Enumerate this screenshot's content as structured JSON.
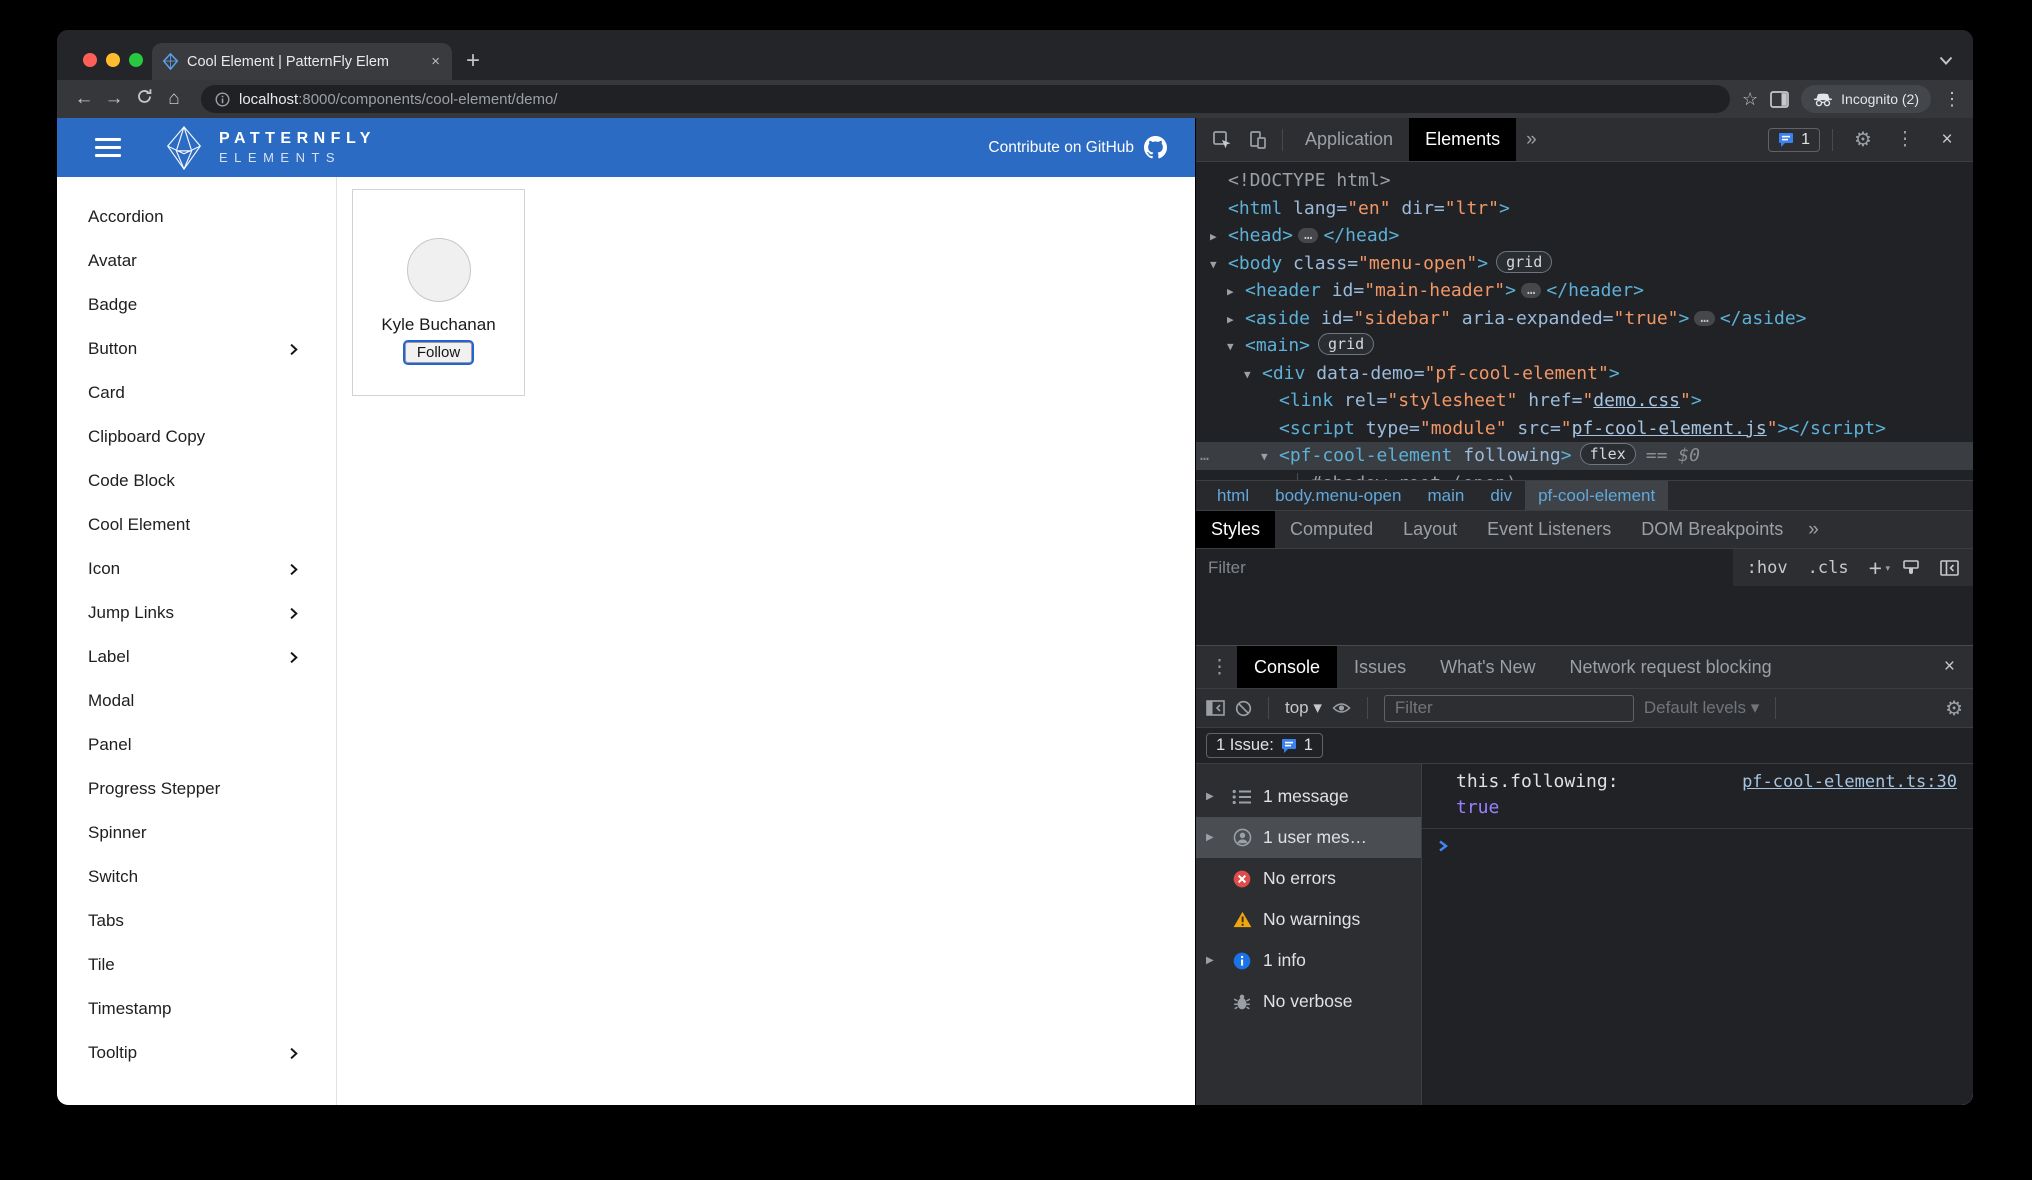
{
  "browser": {
    "tab": {
      "title": "Cool Element | PatternFly Elem"
    },
    "url": {
      "host": "localhost",
      "rest": ":8000/components/cool-element/demo/"
    },
    "incognito": "Incognito (2)"
  },
  "site": {
    "brand": {
      "line1": "PATTERNFLY",
      "line2": "ELEMENTS"
    },
    "contribute": "Contribute on GitHub",
    "nav": [
      {
        "label": "Accordion"
      },
      {
        "label": "Avatar"
      },
      {
        "label": "Badge"
      },
      {
        "label": "Button",
        "expand": true
      },
      {
        "label": "Card"
      },
      {
        "label": "Clipboard Copy"
      },
      {
        "label": "Code Block"
      },
      {
        "label": "Cool Element"
      },
      {
        "label": "Icon",
        "expand": true
      },
      {
        "label": "Jump Links",
        "expand": true
      },
      {
        "label": "Label",
        "expand": true
      },
      {
        "label": "Modal"
      },
      {
        "label": "Panel"
      },
      {
        "label": "Progress Stepper"
      },
      {
        "label": "Spinner"
      },
      {
        "label": "Switch"
      },
      {
        "label": "Tabs"
      },
      {
        "label": "Tile"
      },
      {
        "label": "Timestamp"
      },
      {
        "label": "Tooltip",
        "expand": true
      }
    ],
    "card": {
      "name": "Kyle Buchanan",
      "action": "Follow"
    }
  },
  "devtools": {
    "topbar": {
      "tabs": [
        {
          "label": "Application"
        },
        {
          "label": "Elements",
          "active": true
        }
      ],
      "issue_count": "1"
    },
    "tree": [
      {
        "ind": 0,
        "tokens": [
          [
            "doc",
            "<!DOCTYPE html>"
          ]
        ]
      },
      {
        "ind": 0,
        "tokens": [
          [
            "tag",
            "<html"
          ],
          [
            "attr",
            " lang="
          ],
          [
            "val",
            "\"en\""
          ],
          [
            "attr",
            " dir="
          ],
          [
            "val",
            "\"ltr\""
          ],
          [
            "tag",
            ">"
          ]
        ]
      },
      {
        "ind": 0,
        "arrow": "right",
        "tokens": [
          [
            "tag",
            "<head>"
          ],
          [
            "dots",
            "…"
          ],
          [
            "tag",
            "</head>"
          ]
        ]
      },
      {
        "ind": 0,
        "arrow": "down",
        "tokens": [
          [
            "tag",
            "<body"
          ],
          [
            "attr",
            " class="
          ],
          [
            "val",
            "\"menu-open\""
          ],
          [
            "tag",
            ">"
          ],
          [
            "badge",
            "grid"
          ]
        ]
      },
      {
        "ind": 1,
        "arrow": "right",
        "tokens": [
          [
            "tag",
            "<header"
          ],
          [
            "attr",
            " id="
          ],
          [
            "val",
            "\"main-header\""
          ],
          [
            "tag",
            ">"
          ],
          [
            "dots",
            "…"
          ],
          [
            "tag",
            "</header>"
          ]
        ]
      },
      {
        "ind": 1,
        "arrow": "right",
        "tokens": [
          [
            "tag",
            "<aside"
          ],
          [
            "attr",
            " id="
          ],
          [
            "val",
            "\"sidebar\""
          ],
          [
            "attr",
            " aria-expanded="
          ],
          [
            "val",
            "\"true\""
          ],
          [
            "tag",
            ">"
          ],
          [
            "dots",
            "…"
          ],
          [
            "tag",
            "</aside>"
          ]
        ]
      },
      {
        "ind": 1,
        "arrow": "down",
        "tokens": [
          [
            "tag",
            "<main>"
          ],
          [
            "badge",
            "grid"
          ]
        ]
      },
      {
        "ind": 2,
        "arrow": "down",
        "tokens": [
          [
            "tag",
            "<div"
          ],
          [
            "attr",
            " data-demo="
          ],
          [
            "val",
            "\"pf-cool-element\""
          ],
          [
            "tag",
            ">"
          ]
        ]
      },
      {
        "ind": 3,
        "tokens": [
          [
            "tag",
            "<link"
          ],
          [
            "attr",
            " rel="
          ],
          [
            "val",
            "\"stylesheet\""
          ],
          [
            "attr",
            " href="
          ],
          [
            "vlink",
            "demo.css"
          ],
          [
            "tag",
            ">"
          ]
        ]
      },
      {
        "ind": 3,
        "tokens": [
          [
            "tag",
            "<script"
          ],
          [
            "attr",
            " type="
          ],
          [
            "val",
            "\"module\""
          ],
          [
            "attr",
            " src="
          ],
          [
            "vlink",
            "pf-cool-element.js"
          ],
          [
            "tag",
            "></script>"
          ]
        ]
      },
      {
        "ind": 3,
        "arrow": "down",
        "selected": true,
        "tokens": [
          [
            "tag",
            "<pf-cool-element"
          ],
          [
            "attr",
            " following"
          ],
          [
            "tag",
            ">"
          ],
          [
            "badge",
            "flex"
          ],
          [
            "eq",
            "== $0"
          ]
        ]
      },
      {
        "ind": 4,
        "arrow": "right",
        "guide": true,
        "tokens": [
          [
            "shadow",
            "#shadow-root"
          ],
          [
            "doc",
            " (open)"
          ]
        ]
      }
    ],
    "breadcrumbs": [
      {
        "label": "html"
      },
      {
        "label": "body.menu-open"
      },
      {
        "label": "main"
      },
      {
        "label": "div"
      },
      {
        "label": "pf-cool-element",
        "active": true
      }
    ],
    "styles_tabs": [
      {
        "label": "Styles",
        "active": true
      },
      {
        "label": "Computed"
      },
      {
        "label": "Layout"
      },
      {
        "label": "Event Listeners"
      },
      {
        "label": "DOM Breakpoints"
      }
    ],
    "styles_filter": {
      "placeholder": "Filter",
      "hov": ":hov",
      "cls": ".cls",
      "add": "+"
    },
    "drawer_tabs": [
      {
        "label": "Console",
        "active": true
      },
      {
        "label": "Issues"
      },
      {
        "label": "What's New"
      },
      {
        "label": "Network request blocking"
      }
    ],
    "console_toolbar": {
      "context": "top",
      "filter_placeholder": "Filter",
      "levels": "Default levels"
    },
    "issue_bar": {
      "label": "1 Issue:",
      "count": "1"
    },
    "console_sidebar": [
      {
        "icon": "list",
        "label": "1 message",
        "arrow": true
      },
      {
        "icon": "user",
        "label": "1 user mes…",
        "arrow": true,
        "selected": true
      },
      {
        "icon": "error",
        "label": "No errors"
      },
      {
        "icon": "warning",
        "label": "No warnings"
      },
      {
        "icon": "info",
        "label": "1 info",
        "arrow": true
      },
      {
        "icon": "verbose",
        "label": "No verbose"
      }
    ],
    "console_message": {
      "label": "this.following:",
      "value": "true",
      "source": "pf-cool-element.ts:30"
    }
  }
}
